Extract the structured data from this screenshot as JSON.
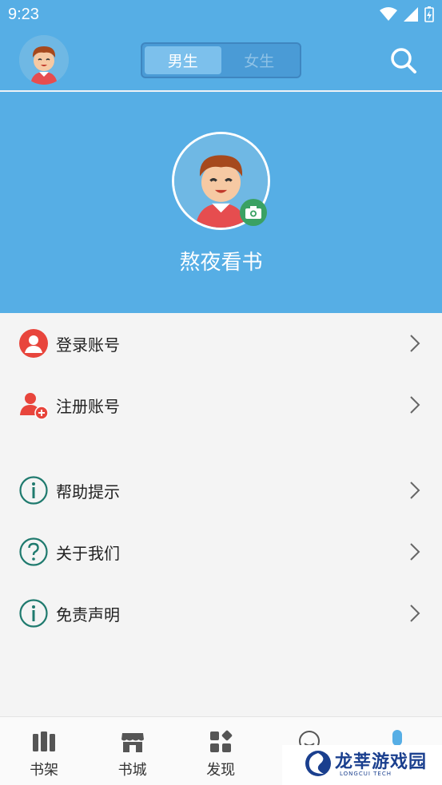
{
  "status_bar": {
    "time": "9:23"
  },
  "header": {
    "tabs": [
      {
        "label": "男生",
        "active": true
      },
      {
        "label": "女生",
        "active": false
      }
    ]
  },
  "profile": {
    "name": "熬夜看书"
  },
  "menu": {
    "items": [
      {
        "label": "登录账号",
        "icon": "user-login-icon"
      },
      {
        "label": "注册账号",
        "icon": "user-register-icon"
      },
      {
        "label": "帮助提示",
        "icon": "info-icon"
      },
      {
        "label": "关于我们",
        "icon": "question-icon"
      },
      {
        "label": "免责声明",
        "icon": "info-icon"
      }
    ]
  },
  "bottom_nav": {
    "items": [
      {
        "label": "书架",
        "icon": "bookshelf-icon"
      },
      {
        "label": "书城",
        "icon": "store-icon"
      },
      {
        "label": "发现",
        "icon": "discover-icon"
      },
      {
        "label": "",
        "icon": "community-icon"
      },
      {
        "label": "",
        "icon": "profile-icon"
      }
    ]
  },
  "watermark": {
    "title": "龙莘游戏园",
    "subtitle": "LONGCUI TECH"
  },
  "colors": {
    "primary": "#56aee5",
    "login_red": "#e8453c",
    "info_green": "#1f7a6e",
    "camera_green": "#3aa163"
  }
}
